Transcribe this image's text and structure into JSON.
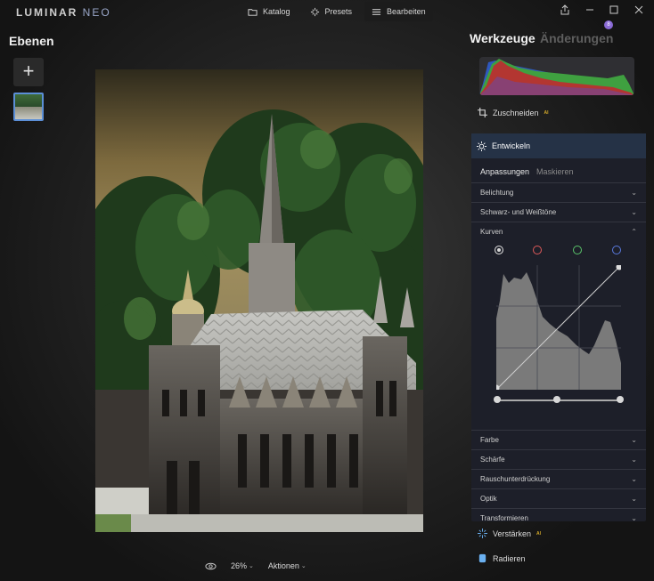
{
  "app": {
    "logo_main": "LUMINAR",
    "logo_neo": "NEO"
  },
  "topnav": {
    "tabs": [
      {
        "label": "Katalog",
        "icon": "folder-icon"
      },
      {
        "label": "Presets",
        "icon": "sparkle-icon"
      },
      {
        "label": "Bearbeiten",
        "icon": "sliders-icon",
        "active": true
      }
    ]
  },
  "window_controls": [
    "share-icon",
    "minimize-icon",
    "maximize-icon",
    "close-icon"
  ],
  "left": {
    "title": "Ebenen",
    "add_label": "+"
  },
  "bottom": {
    "zoom": "26%",
    "actions": "Aktionen"
  },
  "right": {
    "title_active": "Werkzeuge",
    "title_inactive": "Änderungen",
    "badge": "8",
    "crop_label": "Zuschneiden",
    "ai_tag": "AI",
    "develop": {
      "title": "Entwickeln",
      "tab_adjust": "Anpassungen",
      "tab_mask": "Maskieren",
      "sections_top": [
        "Belichtung",
        "Schwarz- und Weißtöne",
        "Kurven"
      ],
      "sections_bottom": [
        "Farbe",
        "Schärfe",
        "Rauschunterdrückung",
        "Optik",
        "Transformieren"
      ]
    },
    "enhance_label": "Verstärken",
    "erase_label": "Radieren"
  },
  "colors": {
    "accent": "#5b8ed6",
    "curve_white": "#d8d8d8",
    "curve_red": "#e05a5a",
    "curve_green": "#5ac46a",
    "curve_blue": "#5a7ae0",
    "ai_gold": "#d4aa2a"
  }
}
